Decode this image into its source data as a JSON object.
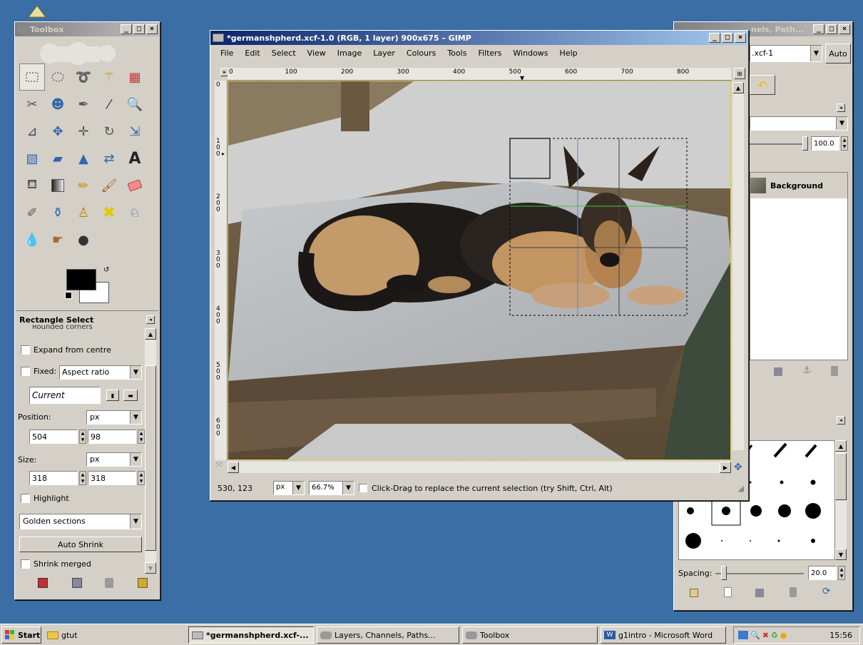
{
  "toolbox": {
    "title": "Toolbox",
    "tool_options_title": "Rectangle Select",
    "rounded_corners": "Rounded corners",
    "expand_from_centre": "Expand from centre",
    "fixed_label": "Fixed:",
    "fixed_value": "Aspect ratio",
    "current_value": "Current",
    "position_label": "Position:",
    "position_unit": "px",
    "position_x": "504",
    "position_y": "98",
    "size_label": "Size:",
    "size_unit": "px",
    "size_w": "318",
    "size_h": "318",
    "highlight": "Highlight",
    "guides_value": "Golden sections",
    "auto_shrink": "Auto Shrink",
    "shrink_merged": "Shrink merged"
  },
  "image_window": {
    "title": "*germanshpherd.xcf-1.0 (RGB, 1 layer) 900x675 – GIMP",
    "menu": [
      "File",
      "Edit",
      "Select",
      "View",
      "Image",
      "Layer",
      "Colours",
      "Tools",
      "Filters",
      "Windows",
      "Help"
    ],
    "ruler_h": [
      "0",
      "100",
      "200",
      "300",
      "400",
      "500",
      "600",
      "700",
      "800"
    ],
    "ruler_v": [
      "0",
      "100",
      "200",
      "300",
      "400",
      "500",
      "600"
    ],
    "coords": "530, 123",
    "unit": "px",
    "zoom": "66.7%",
    "status": "Click-Drag to replace the current selection (try Shift, Ctrl, Alt)"
  },
  "layers_window": {
    "title": "Layers, Channels, Paths...",
    "title_visible": "nels, Path...",
    "image_menu": ".xcf-1",
    "auto_label": "Auto",
    "opacity": "100.0",
    "layer_name": "Background",
    "spacing_label": "Spacing:",
    "spacing_value": "20.0"
  },
  "taskbar": {
    "start": "Start",
    "items": [
      "gtut",
      "*germanshpherd.xcf-...",
      "Layers, Channels, Paths...",
      "Toolbox",
      "g1intro - Microsoft Word"
    ],
    "clock": "15:56"
  },
  "colors": {
    "desktop": "#3a6ea5",
    "title_active": "#0a246a",
    "grid_green": "#40c040",
    "selection": "#000000"
  }
}
